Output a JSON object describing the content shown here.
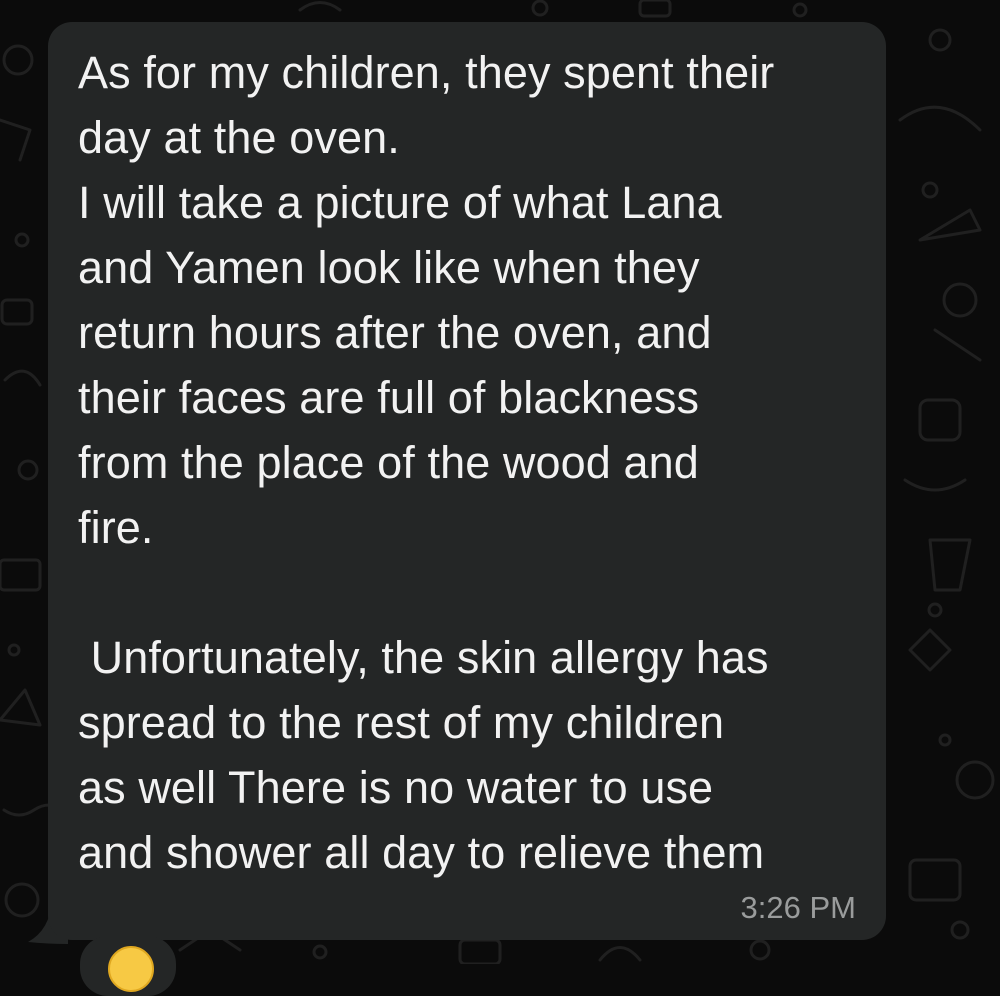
{
  "message": {
    "lines": [
      "As for my children, they spent their",
      "day at the oven.",
      "I will take a picture of what Lana",
      "and Yamen look like when they",
      "return hours after the oven, and",
      "their faces are full of blackness",
      "from the place of the wood and",
      "fire.",
      "",
      " Unfortunately, the skin allergy has",
      "spread to the rest of my children",
      "as well There is no water to use",
      "and shower all day to relieve them"
    ],
    "timestamp": "3:26 PM"
  },
  "next_message": {
    "reaction_icon": "emoji-face-icon"
  },
  "colors": {
    "background": "#0b0b0b",
    "bubble": "#242626",
    "text": "#f2f2f2",
    "timestamp": "#9a9c9c",
    "doodle": "#1f1f1f"
  }
}
